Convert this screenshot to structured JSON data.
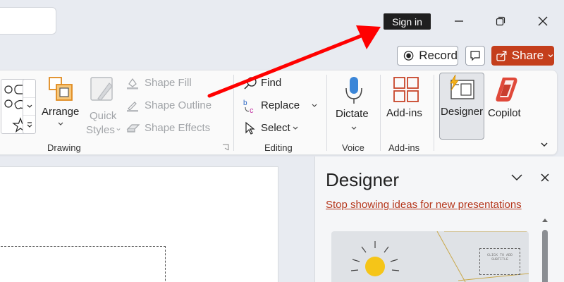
{
  "titlebar": {
    "sign_in_label": "Sign in"
  },
  "actions": {
    "record_label": "Record",
    "share_label": "Share",
    "share_color": "#c43e1c"
  },
  "ribbon": {
    "drawing": {
      "arrange_label": "Arrange",
      "quick_styles_line1": "Quick",
      "quick_styles_line2": "Styles",
      "shape_fill_label": "Shape Fill",
      "shape_outline_label": "Shape Outline",
      "shape_effects_label": "Shape Effects",
      "group_label": "Drawing"
    },
    "editing": {
      "find_label": "Find",
      "replace_label": "Replace",
      "select_label": "Select",
      "group_label": "Editing"
    },
    "voice": {
      "dictate_label": "Dictate",
      "group_label": "Voice"
    },
    "addins": {
      "addins_label": "Add-ins",
      "group_label": "Add-ins"
    },
    "designer_label": "Designer",
    "copilot_label": "Copilot"
  },
  "designer_pane": {
    "title": "Designer",
    "stop_link": "Stop showing ideas for new presentations",
    "thumb_text": "CLICK TO ADD SUBTITLE"
  },
  "annotation": {
    "arrow_color": "#ff0000",
    "arrow_target": "sign-in-badge"
  },
  "icons": [
    "search-box",
    "minimize-icon",
    "maximize-icon",
    "close-icon",
    "record-icon",
    "comment-icon",
    "share-icon",
    "arrange-icon",
    "quick-styles-icon",
    "shape-fill-icon",
    "shape-outline-icon",
    "shape-effects-icon",
    "find-icon",
    "replace-icon",
    "select-icon",
    "microphone-icon",
    "add-ins-icon",
    "designer-icon",
    "copilot-icon"
  ]
}
